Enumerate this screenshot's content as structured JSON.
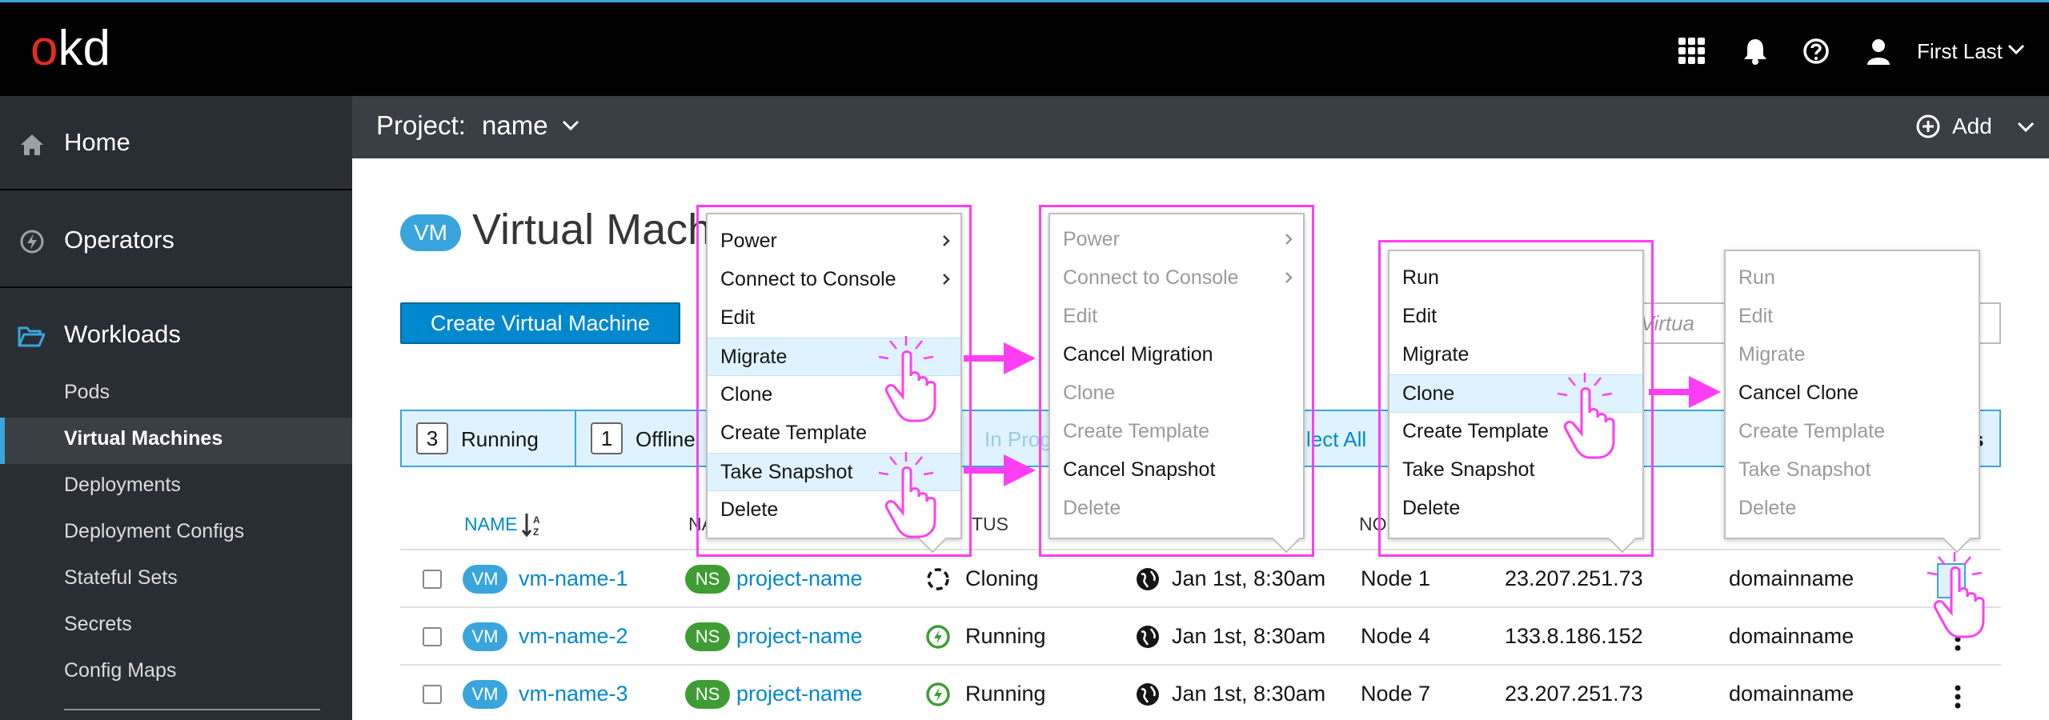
{
  "masthead": {
    "logo_o": "o",
    "logo_kd": "kd",
    "user_name": "First Last",
    "accent": "#39a5dc",
    "logo_red": "#e12e1f"
  },
  "sidebar": {
    "sections": [
      {
        "label": "Home",
        "icon": "home-icon"
      },
      {
        "label": "Operators",
        "icon": "operators-icon"
      },
      {
        "label": "Workloads",
        "icon": "folder-open-icon"
      }
    ],
    "workload_items": [
      "Pods",
      "Virtual Machines",
      "Deployments",
      "Deployment Configs",
      "Stateful Sets",
      "Secrets",
      "Config Maps"
    ]
  },
  "projectbar": {
    "label": "Project:",
    "name": "name",
    "add_label": "Add"
  },
  "main": {
    "title_badge": "VM",
    "title": "Virtual Mach",
    "create_button": "Create Virtual Machine",
    "filter_placeholder": "ter Virtua",
    "status_bar": {
      "running_count": "3",
      "running_label": "Running",
      "offline_count": "1",
      "offline_label": "Offline",
      "in_progress_label": "In Prog",
      "select_all_label": "lect All",
      "trailing_label": "s"
    },
    "columns": {
      "name": "NAME",
      "namespace": "NA",
      "status": "TUS",
      "node": "NO"
    },
    "rows": [
      {
        "badge": "VM",
        "name": "vm-name-1",
        "ns_badge": "NS",
        "namespace": "project-name",
        "status": "Cloning",
        "created": "Jan 1st, 8:30am",
        "node": "Node 1",
        "ip": "23.207.251.73",
        "domain": "domainname"
      },
      {
        "badge": "VM",
        "name": "vm-name-2",
        "ns_badge": "NS",
        "namespace": "project-name",
        "status": "Running",
        "created": "Jan 1st, 8:30am",
        "node": "Node 4",
        "ip": "133.8.186.152",
        "domain": "domainname"
      },
      {
        "badge": "VM",
        "name": "vm-name-3",
        "ns_badge": "NS",
        "namespace": "project-name",
        "status": "Running",
        "created": "Jan 1st, 8:30am",
        "node": "Node 7",
        "ip": "23.207.251.73",
        "domain": "domainname"
      }
    ]
  },
  "menus": {
    "menu1": [
      "Power",
      "Connect to Console",
      "Edit",
      "Migrate",
      "Clone",
      "Create Template",
      "Take Snapshot",
      "Delete"
    ],
    "menu2": [
      "Power",
      "Connect to Console",
      "Edit",
      "Cancel Migration",
      "Clone",
      "Create Template",
      "Cancel Snapshot",
      "Delete"
    ],
    "menu3": [
      "Run",
      "Edit",
      "Migrate",
      "Clone",
      "Create Template",
      "Take Snapshot",
      "Delete"
    ],
    "menu4": [
      "Run",
      "Edit",
      "Migrate",
      "Cancel Clone",
      "Create Template",
      "Take Snapshot",
      "Delete"
    ]
  },
  "annotation_color": "#ff3ef3"
}
